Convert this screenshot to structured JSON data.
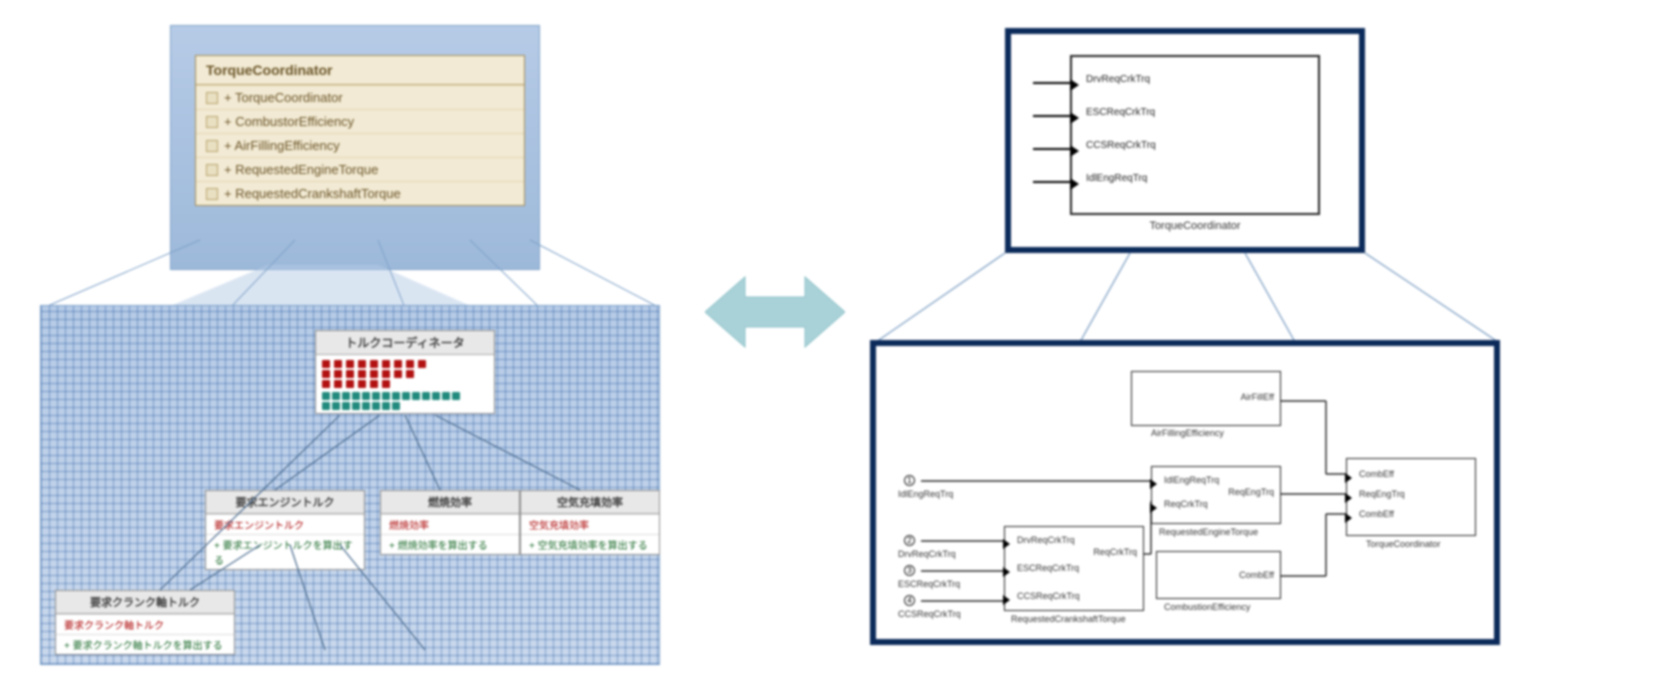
{
  "left": {
    "class_box": {
      "title": "TorqueCoordinator",
      "rows": [
        "+ TorqueCoordinator",
        "+ CombustorEfficiency",
        "+ AirFillingEfficiency",
        "+ RequestedEngineTorque",
        "+ RequestedCrankshaftTorque"
      ]
    },
    "root_node": {
      "title": "トルクコーディネータ",
      "bars_red_rows": 3,
      "bars_teal_count": 22
    },
    "children": [
      {
        "title": "要求エンジントルク",
        "red": "要求エンジントルク",
        "green": "+ 要求エンジントルクを算出する"
      },
      {
        "title": "燃焼効率",
        "red": "燃焼効率",
        "green": "+ 燃焼効率を算出する"
      },
      {
        "title": "空気充填効率",
        "red": "空気充填効率",
        "green": "+ 空気充填効率を算出する"
      }
    ],
    "grandchild": {
      "title": "要求クランク軸トルク",
      "red": "要求クランク軸トルク",
      "green": "+ 要求クランク軸トルクを算出する"
    }
  },
  "center": {
    "arrow_color": "#9fcfd6"
  },
  "right_top": {
    "block_name": "TorqueCoordinator",
    "ports": [
      "DrvReqCrkTrq",
      "ESCReqCrkTrq",
      "CCSReqCrkTrq",
      "IdlEngReqTrq"
    ]
  },
  "right_bottom": {
    "inputs": [
      {
        "n": 1,
        "label": "IdlEngReqTrq"
      },
      {
        "n": 2,
        "label": "DrvReqCrkTrq"
      },
      {
        "n": 3,
        "label": "ESCReqCrkTrq"
      },
      {
        "n": 4,
        "label": "CCSReqCrkTrq"
      }
    ],
    "blocks": {
      "airfill": {
        "label": "AirFillingEfficiency",
        "out": "AirFillEff"
      },
      "reqcrank": {
        "label": "RequestedCrankshaftTorque",
        "ins": [
          "DrvReqCrkTrq",
          "ESCReqCrkTrq",
          "CCSReqCrkTrq"
        ],
        "out": "ReqCrkTrq"
      },
      "reqeng": {
        "label": "RequestedEngineTorque",
        "ins": [
          "IdlEngReqTrq",
          "ReqCrkTrq"
        ],
        "out": "ReqEngTrq"
      },
      "combust": {
        "label": "CombustionEfficiency",
        "out": "CombEff"
      },
      "coord": {
        "label": "TorqueCoordinator",
        "ins": [
          "CombEff",
          "ReqEngTrq",
          "CombEff"
        ]
      }
    }
  }
}
